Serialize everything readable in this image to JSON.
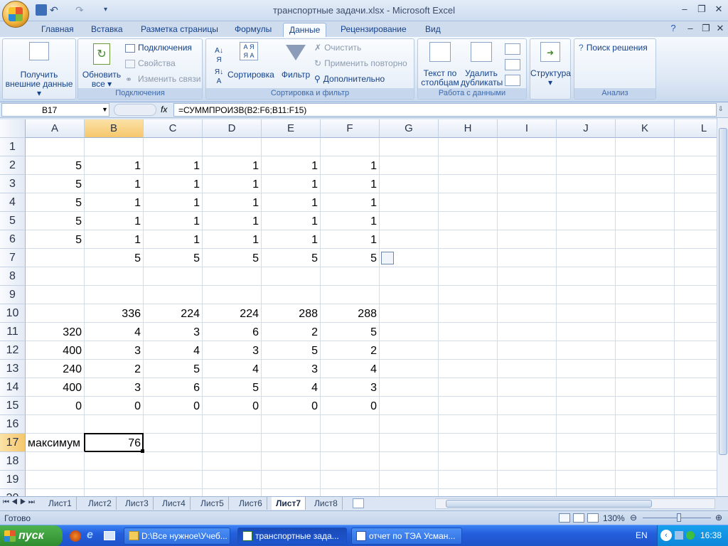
{
  "window": {
    "title": "транспортные задачи.xlsx - Microsoft Excel"
  },
  "ribbon": {
    "tabs": [
      "Главная",
      "Вставка",
      "Разметка страницы",
      "Формулы",
      "Данные",
      "Рецензирование",
      "Вид"
    ],
    "active_tab": "Данные",
    "groups": {
      "external": {
        "btn1": "Получить",
        "btn2": "внешние данные"
      },
      "connections": {
        "refresh1": "Обновить",
        "refresh2": "все",
        "connections": "Подключения",
        "properties": "Свойства",
        "edit_links": "Изменить связи",
        "label": "Подключения"
      },
      "sort_filter": {
        "sort": "Сортировка",
        "filter": "Фильтр",
        "clear": "Очистить",
        "reapply": "Применить повторно",
        "advanced": "Дополнительно",
        "label": "Сортировка и фильтр"
      },
      "data_tools": {
        "text_to_cols1": "Текст по",
        "text_to_cols2": "столбцам",
        "remove_dup1": "Удалить",
        "remove_dup2": "дубликаты",
        "label": "Работа с данными"
      },
      "outline": {
        "btn": "Структура"
      },
      "analysis": {
        "solver": "Поиск решения",
        "label": "Анализ"
      }
    }
  },
  "formula_bar": {
    "name_box": "B17",
    "fx": "fx",
    "formula": "=СУММПРОИЗВ(B2:F6;B11:F15)"
  },
  "columns": [
    "A",
    "B",
    "C",
    "D",
    "E",
    "F",
    "G",
    "H",
    "I",
    "J",
    "K",
    "L"
  ],
  "rows": [
    "1",
    "2",
    "3",
    "4",
    "5",
    "6",
    "7",
    "8",
    "9",
    "10",
    "11",
    "12",
    "13",
    "14",
    "15",
    "16",
    "17",
    "18",
    "19",
    "20"
  ],
  "cells": [
    [
      "",
      "",
      "",
      "",
      "",
      ""
    ],
    [
      "5",
      "1",
      "1",
      "1",
      "1",
      "1"
    ],
    [
      "5",
      "1",
      "1",
      "1",
      "1",
      "1"
    ],
    [
      "5",
      "1",
      "1",
      "1",
      "1",
      "1"
    ],
    [
      "5",
      "1",
      "1",
      "1",
      "1",
      "1"
    ],
    [
      "5",
      "1",
      "1",
      "1",
      "1",
      "1"
    ],
    [
      "",
      "5",
      "5",
      "5",
      "5",
      "5"
    ],
    [
      "",
      "",
      "",
      "",
      "",
      ""
    ],
    [
      "",
      "",
      "",
      "",
      "",
      ""
    ],
    [
      "",
      "336",
      "224",
      "224",
      "288",
      "288"
    ],
    [
      "320",
      "4",
      "3",
      "6",
      "2",
      "5"
    ],
    [
      "400",
      "3",
      "4",
      "3",
      "5",
      "2"
    ],
    [
      "240",
      "2",
      "5",
      "4",
      "3",
      "4"
    ],
    [
      "400",
      "3",
      "6",
      "5",
      "4",
      "3"
    ],
    [
      "0",
      "0",
      "0",
      "0",
      "0",
      "0"
    ],
    [
      "",
      "",
      "",
      "",
      "",
      ""
    ],
    [
      "максимум",
      "76",
      "",
      "",
      "",
      ""
    ]
  ],
  "sheets": [
    "Лист1",
    "Лист2",
    "Лист3",
    "Лист4",
    "Лист5",
    "Лист6",
    "Лист7",
    "Лист8"
  ],
  "active_sheet": "Лист7",
  "status": {
    "ready": "Готово",
    "zoom": "130%"
  },
  "taskbar": {
    "start": "пуск",
    "tasks": [
      "D:\\Все нужное\\Учеб...",
      "транспортные зада...",
      "отчет по ТЭА Усман..."
    ],
    "lang": "EN",
    "clock": "16:38"
  },
  "colors": {
    "accent": "#15428b",
    "selected_header": "#f6c76c"
  }
}
